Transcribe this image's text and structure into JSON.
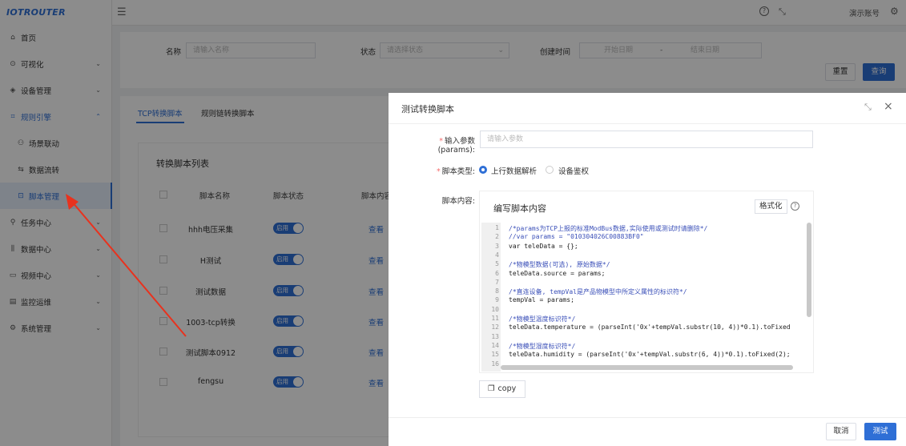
{
  "app": {
    "logo": "IOTROUTER"
  },
  "topbar": {
    "account": "演示账号"
  },
  "sidebar": {
    "items": [
      {
        "label": "首页",
        "icon": "home-icon",
        "glyph": "⌂"
      },
      {
        "label": "可视化",
        "icon": "dashboard-icon",
        "glyph": "⊙",
        "chevron": "⌄"
      },
      {
        "label": "设备管理",
        "icon": "device-icon",
        "glyph": "◈",
        "chevron": "⌄"
      },
      {
        "label": "规则引擎",
        "icon": "rule-icon",
        "glyph": "⌗",
        "chevron": "⌃"
      },
      {
        "label": "场景联动",
        "icon": "scene-icon",
        "glyph": "⚇"
      },
      {
        "label": "数据流转",
        "icon": "flow-icon",
        "glyph": "⇆"
      },
      {
        "label": "脚本管理",
        "icon": "script-icon",
        "glyph": "⊡"
      },
      {
        "label": "任务中心",
        "icon": "task-icon",
        "glyph": "⚲",
        "chevron": "⌄"
      },
      {
        "label": "数据中心",
        "icon": "data-icon",
        "glyph": "⫼",
        "chevron": "⌄"
      },
      {
        "label": "视频中心",
        "icon": "video-icon",
        "glyph": "▭",
        "chevron": "⌄"
      },
      {
        "label": "监控运维",
        "icon": "monitor-icon",
        "glyph": "▤",
        "chevron": "⌄"
      },
      {
        "label": "系统管理",
        "icon": "system-icon",
        "glyph": "⚙",
        "chevron": "⌄"
      }
    ]
  },
  "search": {
    "name_label": "名称",
    "name_placeholder": "请输入名称",
    "status_label": "状态",
    "status_placeholder": "请选择状态",
    "created_label": "创建时间",
    "start_placeholder": "开始日期",
    "range_sep": "-",
    "end_placeholder": "结束日期",
    "reset": "重置",
    "query": "查询"
  },
  "tabs": [
    "TCP转换脚本",
    "规则链转换脚本"
  ],
  "list": {
    "title": "转换脚本列表",
    "columns": [
      "脚本名称",
      "脚本状态",
      "脚本内容"
    ],
    "rows": [
      {
        "name": "hhh电压采集",
        "status": "启用",
        "content": "查看"
      },
      {
        "name": "H测试",
        "status": "启用",
        "content": "查看"
      },
      {
        "name": "测试数据",
        "status": "启用",
        "content": "查看"
      },
      {
        "name": "1003-tcp转换",
        "status": "启用",
        "content": "查看"
      },
      {
        "name": "测试脚本0912",
        "status": "启用",
        "content": "查看"
      },
      {
        "name": "fengsu",
        "status": "启用",
        "content": "查看"
      }
    ]
  },
  "dialog": {
    "title": "测试转换脚本",
    "params_label": "输入参数(params):",
    "params_placeholder": "请输入参数",
    "type_label": "脚本类型:",
    "type_options": [
      "上行数据解析",
      "设备鉴权"
    ],
    "type_selected": "上行数据解析",
    "content_label": "脚本内容:",
    "editor_title": "编写脚本内容",
    "format_button": "格式化",
    "code": [
      {
        "n": "1",
        "text": "/*params为TCP上报的标准ModBus数据,实际使用或测试时请删除*/",
        "comment": true
      },
      {
        "n": "2",
        "text": "//var params = \"010304026C00883BF0\"",
        "comment": true
      },
      {
        "n": "3",
        "text": "var teleData = {};",
        "comment": false
      },
      {
        "n": "4",
        "text": "",
        "comment": false
      },
      {
        "n": "5",
        "text": "/*物模型数据(可选), 原始数据*/",
        "comment": true
      },
      {
        "n": "6",
        "text": "teleData.source = params;",
        "comment": false
      },
      {
        "n": "7",
        "text": "",
        "comment": false
      },
      {
        "n": "8",
        "text": "/*直连设备, tempVal是产品物模型中所定义属性的标识符*/",
        "comment": true
      },
      {
        "n": "9",
        "text": "tempVal = params;",
        "comment": false
      },
      {
        "n": "10",
        "text": "",
        "comment": false
      },
      {
        "n": "11",
        "text": "/*物模型温度标识符*/",
        "comment": true
      },
      {
        "n": "12",
        "text": "teleData.temperature = (parseInt('0x'+tempVal.substr(10, 4))*0.1).toFixed",
        "comment": false
      },
      {
        "n": "13",
        "text": "",
        "comment": false
      },
      {
        "n": "14",
        "text": "/*物模型湿度标识符*/",
        "comment": true
      },
      {
        "n": "15",
        "text": "teleData.humidity = (parseInt('0x'+tempVal.substr(6, 4))*0.1).toFixed(2);",
        "comment": false
      },
      {
        "n": "16",
        "text": "",
        "comment": false
      }
    ],
    "copy_button": "copy",
    "cancel": "取消",
    "test": "测试"
  },
  "colors": {
    "primary": "#2f6fd6",
    "annotation_arrow": "#e8321e"
  }
}
